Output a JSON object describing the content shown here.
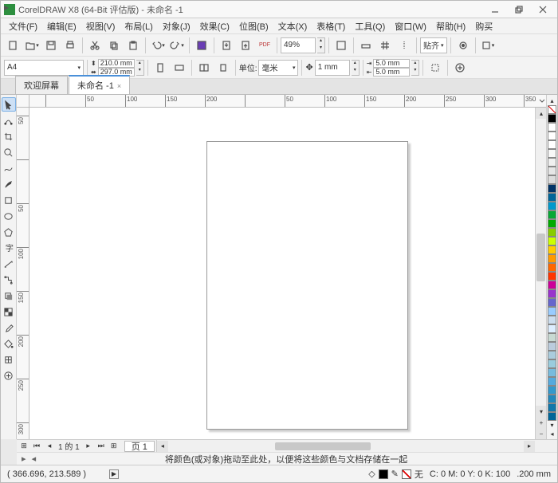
{
  "title": "CorelDRAW X8 (64-Bit 评估版) - 未命名 -1",
  "menus": [
    "文件(F)",
    "编辑(E)",
    "视图(V)",
    "布局(L)",
    "对象(J)",
    "效果(C)",
    "位图(B)",
    "文本(X)",
    "表格(T)",
    "工具(Q)",
    "窗口(W)",
    "帮助(H)",
    "购买"
  ],
  "toolbar1": {
    "zoom": "49%"
  },
  "propbar": {
    "paper": "A4",
    "width": "210.0 mm",
    "height": "297.0 mm",
    "units_label": "单位:",
    "units_value": "毫米",
    "nudge": "1 mm",
    "dup_x": "5.0 mm",
    "dup_y": "5.0 mm",
    "snap_label": "贴齐"
  },
  "doctabs": {
    "welcome": "欢迎屏幕",
    "doc": "未命名 -1"
  },
  "ruler_h": [
    "",
    "50",
    "100",
    "150",
    "200",
    "",
    "50",
    "100",
    "150",
    "200",
    "250",
    "300",
    "350"
  ],
  "ruler_v": [
    "50",
    "",
    "50",
    "100",
    "150",
    "200",
    "250",
    "300"
  ],
  "pagenav": {
    "info": "1 的 1",
    "tab": "页 1"
  },
  "hint": "将颜色(或对象)拖动至此处，以便将这些颜色与文档存储在一起",
  "status": {
    "coord": "( 366.696, 213.589 )",
    "obj": "",
    "cmyk": "C: 0 M: 0 Y: 0 K: 100",
    "stroke": ".200 mm",
    "none_label": "无"
  },
  "palette": [
    "#000",
    "#fff",
    "#fff",
    "#fff",
    "#f8f8f8",
    "#f0f0f0",
    "#e6e6e6",
    "#dcdcdc",
    "#036",
    "#069",
    "#09c",
    "#07a835",
    "#0a0",
    "#8c0",
    "#cf0",
    "#fc0",
    "#f90",
    "#f60",
    "#f30",
    "#c09",
    "#93c",
    "#66c",
    "#9cf",
    "#cde",
    "#def",
    "#c8dad3",
    "#bcd",
    "#acd",
    "#9cd",
    "#7bd",
    "#5ad",
    "#39c",
    "#28b",
    "#17a",
    "#069"
  ]
}
